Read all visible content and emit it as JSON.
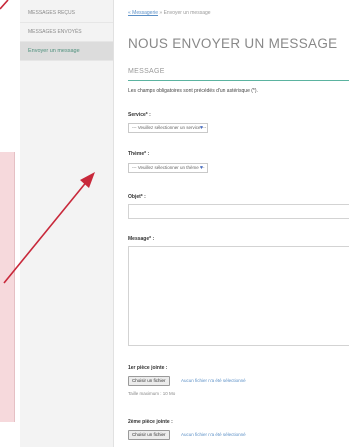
{
  "sidebar": {
    "items": [
      {
        "label": "Messages reçus"
      },
      {
        "label": "Messages envoyés"
      },
      {
        "label": "Envoyer un message"
      }
    ]
  },
  "breadcrumb": {
    "link": "« Messagerie",
    "current": "» Envoyer un message"
  },
  "page": {
    "title": "NOUS ENVOYER UN MESSAGE"
  },
  "form": {
    "section_title": "MESSAGE",
    "required_note": "Les champs obligatoires sont précédés d'un astérisque (*).",
    "service_label": "Service* :",
    "service_value": "--- Veuillez sélectionner un service ---",
    "theme_label": "Thème* :",
    "theme_value": "--- Veuillez sélectionner un thème ---",
    "subject_label": "Objet* :",
    "message_label": "Message* :",
    "attachment1_label": "1er pièce jointe :",
    "choose_file": "Choisir un fichier",
    "no_file": "Aucun fichier n'a été sélectionné",
    "max_size": "Taille maximum : 10 Mo",
    "attachment2_label": "2ème pièce jointe :"
  },
  "colors": {
    "accent": "#5bb3a0",
    "arrow": "#c8283a",
    "left_panel": "#f6d9dc"
  }
}
